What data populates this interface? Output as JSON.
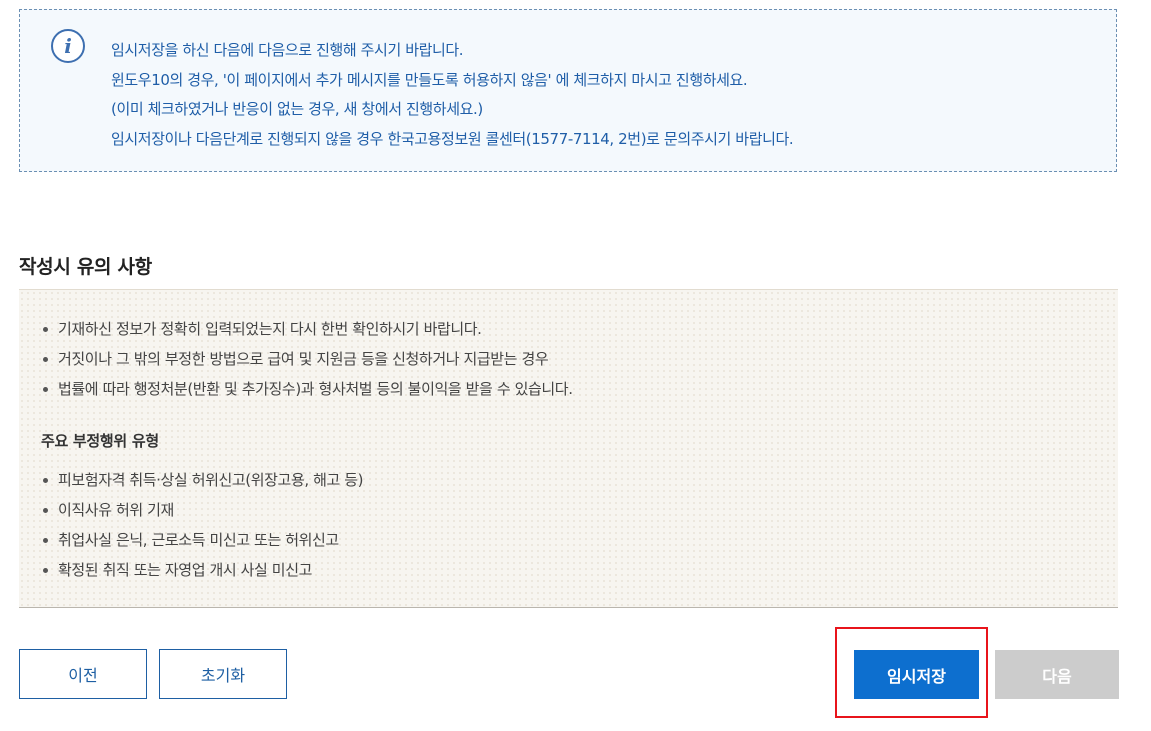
{
  "info": {
    "icon": "info-circle-icon",
    "lines": [
      "임시저장을 하신 다음에 다음으로 진행해 주시기 바랍니다.",
      "윈도우10의 경우, '이 페이지에서 추가 메시지를 만들도록 허용하지 않음' 에 체크하지 마시고 진행하세요.",
      "(이미 체크하였거나 반응이 없는 경우, 새 창에서 진행하세요.)",
      "임시저장이나 다음단계로 진행되지 않을 경우 한국고용정보원 콜센터(1577-7114, 2번)로 문의주시기 바랍니다."
    ]
  },
  "notice": {
    "title": "작성시 유의 사항",
    "items": [
      "기재하신 정보가 정확히 입력되었는지 다시 한번 확인하시기 바랍니다.",
      "거짓이나 그 밖의 부정한 방법으로 급여 및 지원금 등을 신청하거나 지급받는 경우",
      "법률에 따라 행정처분(반환 및 추가징수)과 형사처벌 등의 불이익을 받을 수 있습니다."
    ],
    "subtitle": "주요 부정행위 유형",
    "fraud_items": [
      "피보험자격 취득·상실 허위신고(위장고용, 해고 등)",
      "이직사유 허위 기재",
      "취업사실 은닉, 근로소득 미신고 또는 허위신고",
      "확정된 취직 또는 자영업 개시 사실 미신고"
    ]
  },
  "buttons": {
    "prev": "이전",
    "reset": "초기화",
    "save": "임시저장",
    "next": "다음"
  },
  "colors": {
    "info_text": "#1f5ea8",
    "primary": "#0d6fcf",
    "disabled": "#cccccc",
    "highlight": "#e8141b"
  }
}
